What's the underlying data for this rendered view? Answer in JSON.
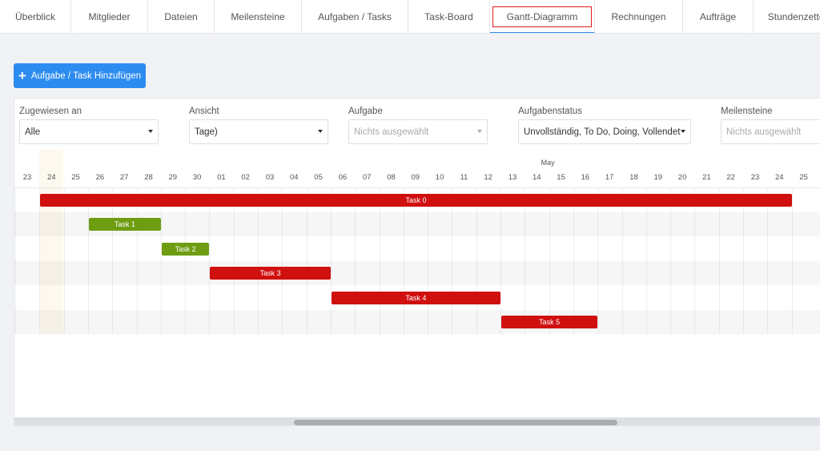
{
  "tabs": [
    {
      "label": "Überblick",
      "name": "tab-ueberblick",
      "active": false
    },
    {
      "label": "Mitglieder",
      "name": "tab-mitglieder",
      "active": false
    },
    {
      "label": "Dateien",
      "name": "tab-dateien",
      "active": false
    },
    {
      "label": "Meilensteine",
      "name": "tab-meilensteine",
      "active": false
    },
    {
      "label": "Aufgaben / Tasks",
      "name": "tab-aufgaben",
      "active": false
    },
    {
      "label": "Task-Board",
      "name": "tab-task-board",
      "active": false
    },
    {
      "label": "Gantt-Diagramm",
      "name": "tab-gantt",
      "active": true
    },
    {
      "label": "Rechnungen",
      "name": "tab-rechnungen",
      "active": false
    },
    {
      "label": "Aufträge",
      "name": "tab-auftraege",
      "active": false
    },
    {
      "label": "Stundenzettel",
      "name": "tab-stundenzettel",
      "active": false
    }
  ],
  "add_button": {
    "label": "Aufgabe / Task Hinzufügen",
    "icon": "plus-icon"
  },
  "filters": [
    {
      "label": "Zugewiesen an",
      "value": "Alle",
      "placeholder": false,
      "name": "assigned-to-select"
    },
    {
      "label": "Ansicht",
      "value": "Tage)",
      "placeholder": false,
      "name": "view-select"
    },
    {
      "label": "Aufgabe",
      "value": "Nichts ausgewählt",
      "placeholder": true,
      "name": "task-select"
    },
    {
      "label": "Aufgabenstatus",
      "value": "Unvollständig, To Do, Doing, Vollendet",
      "placeholder": false,
      "name": "task-status-select"
    },
    {
      "label": "Meilensteine",
      "value": "Nichts ausgewählt",
      "placeholder": true,
      "name": "milestones-select"
    }
  ],
  "gantt": {
    "month_label": "May",
    "days": [
      "23",
      "24",
      "25",
      "26",
      "27",
      "28",
      "29",
      "30",
      "01",
      "02",
      "03",
      "04",
      "05",
      "06",
      "07",
      "08",
      "09",
      "10",
      "11",
      "12",
      "13",
      "14",
      "15",
      "16",
      "17",
      "18",
      "19",
      "20",
      "21",
      "22",
      "23",
      "24",
      "25"
    ],
    "today_index": 1,
    "tasks": [
      {
        "name": "Task 0",
        "start": 1,
        "end": 32,
        "color": "#d0100f"
      },
      {
        "name": "Task 1",
        "start": 3,
        "end": 6,
        "color": "#6e9d12"
      },
      {
        "name": "Task 2",
        "start": 6,
        "end": 8,
        "color": "#6e9d12"
      },
      {
        "name": "Task 3",
        "start": 8,
        "end": 13,
        "color": "#d0100f"
      },
      {
        "name": "Task 4",
        "start": 13,
        "end": 20,
        "color": "#d0100f"
      },
      {
        "name": "Task 5",
        "start": 20,
        "end": 24,
        "color": "#d0100f"
      }
    ],
    "scroll_fraction": 0.4
  },
  "colors": {
    "accent": "#2d8cf0",
    "active_tab_outline": "#e0191b"
  }
}
